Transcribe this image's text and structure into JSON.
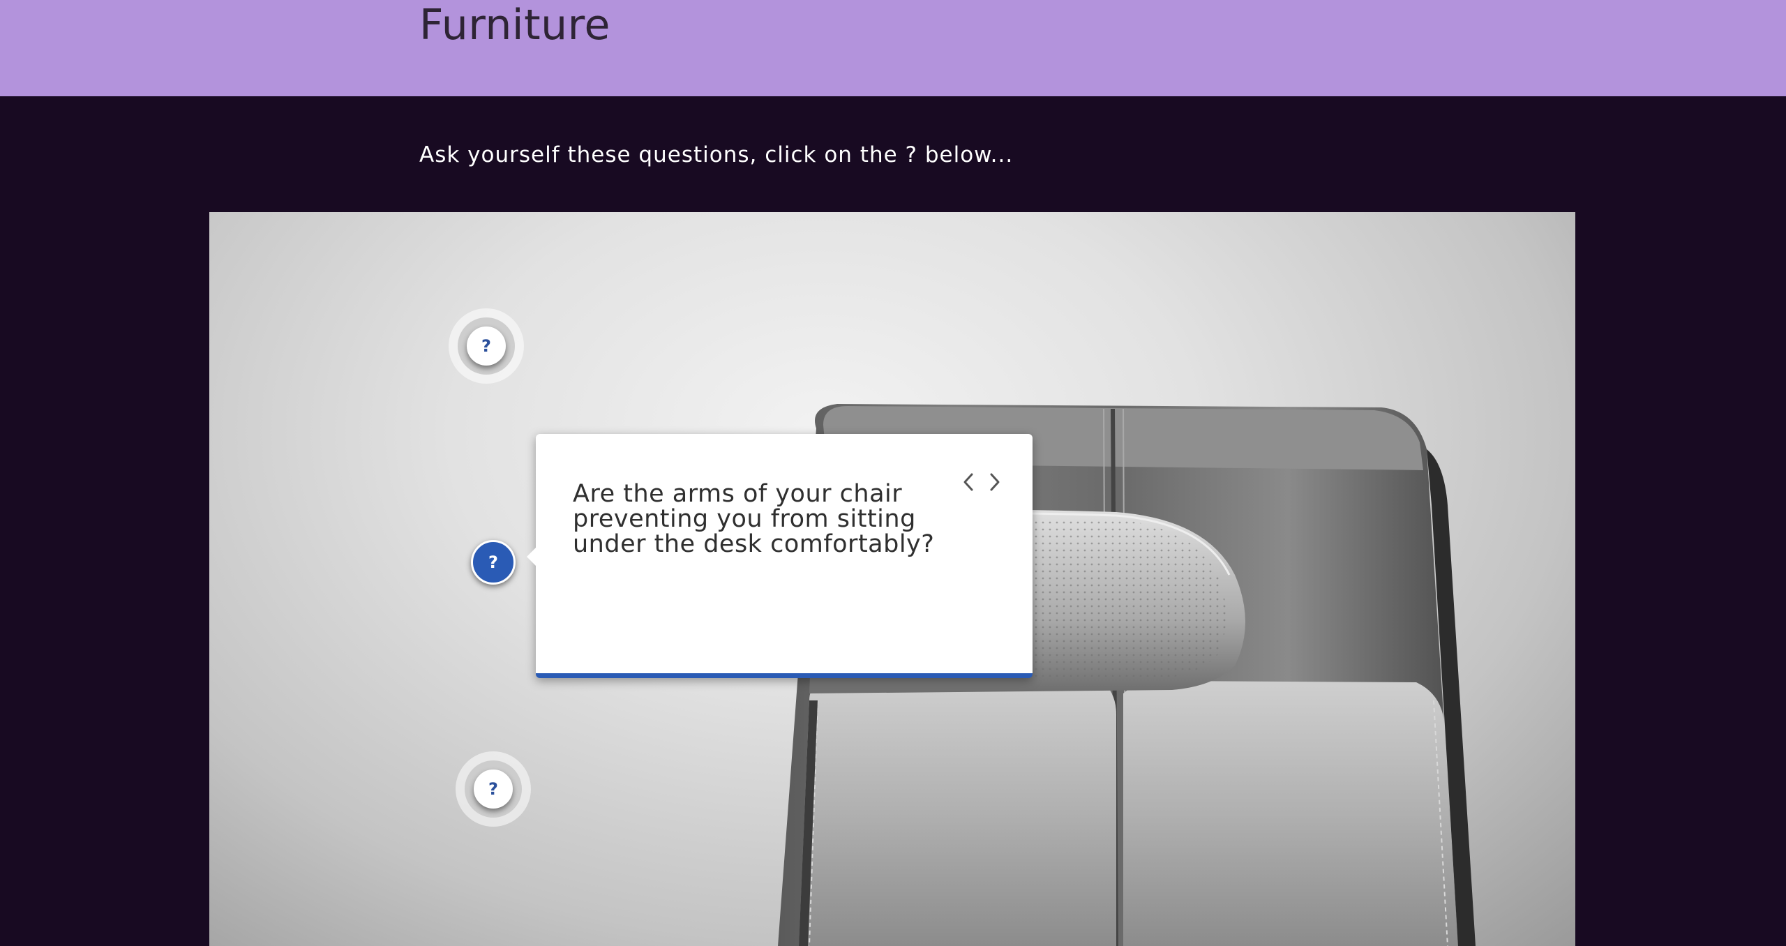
{
  "header": {
    "title": "Furniture",
    "background_color": "#b393dc"
  },
  "intro": {
    "text": "Ask yourself these questions, click on the ? below..."
  },
  "hotspots": [
    {
      "label": "?",
      "state": "inactive"
    },
    {
      "label": "?",
      "state": "active"
    },
    {
      "label": "?",
      "state": "inactive"
    }
  ],
  "popup": {
    "question": "Are the arms of your chair preventing you from sitting under the desk comfortably?",
    "prev_icon": "chevron-left-icon",
    "next_icon": "chevron-right-icon",
    "accent_color": "#2a5bb5"
  },
  "scene": {
    "image_subject": "office-chair-armrest"
  }
}
